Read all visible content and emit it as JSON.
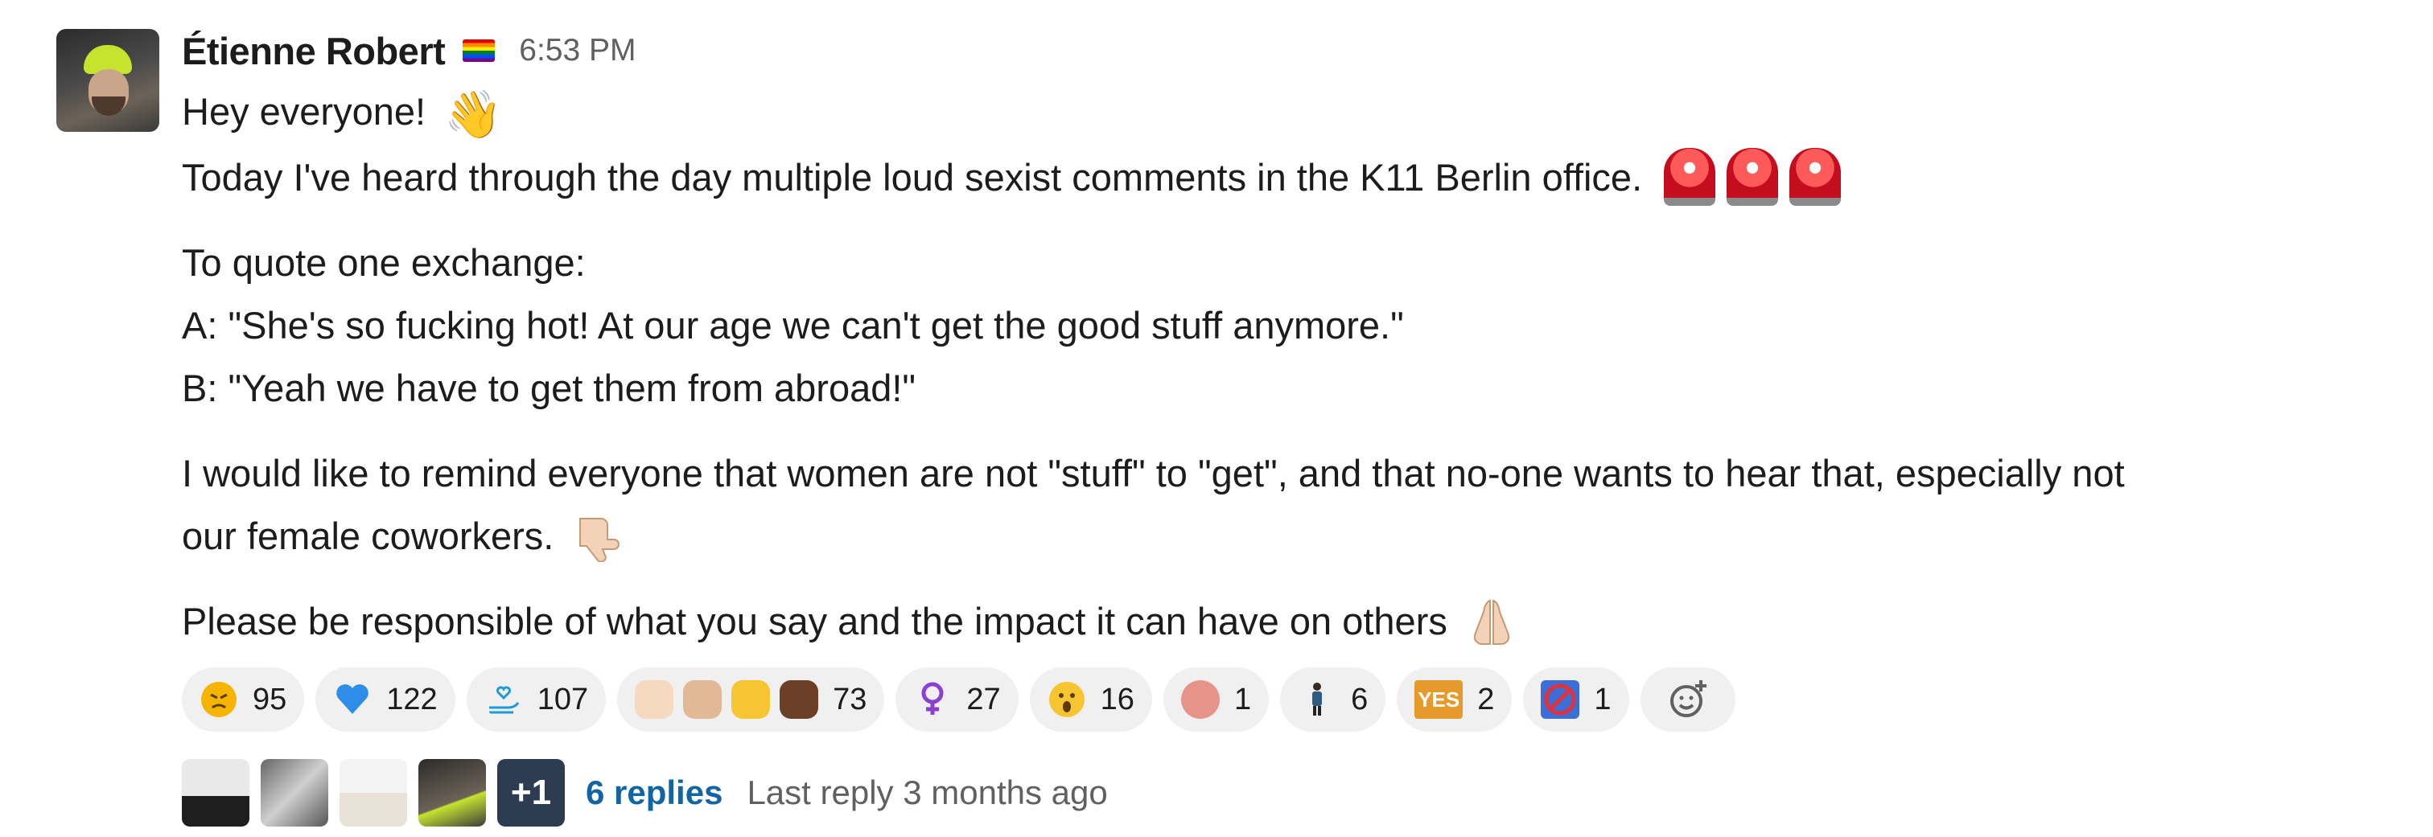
{
  "message": {
    "author": "Étienne Robert",
    "timestamp": "6:53 PM",
    "lines": {
      "greeting": "Hey everyone!",
      "l1": "Today I've heard through the day multiple loud sexist comments in the K11 Berlin office.",
      "q0": "To quote one exchange:",
      "q1": "A: \"She's so fucking hot! At our age we can't get the good stuff anymore.\"",
      "q2": "B: \"Yeah we have to get them from abroad!\"",
      "r1": "I would like to remind everyone that women are not \"stuff\" to \"get\", and that no-one wants to hear that, especially not",
      "r2": "our female coworkers.",
      "p1": "Please be responsible of what you say and the impact it can have on others"
    }
  },
  "reactions": [
    {
      "icon": "angry-face-icon",
      "count": "95"
    },
    {
      "icon": "blue-heart-icon",
      "count": "122"
    },
    {
      "icon": "helping-hand-heart-icon",
      "count": "107"
    },
    {
      "icon": "raised-fist-skin-tones-icon",
      "count": "73"
    },
    {
      "icon": "female-sign-icon",
      "count": "27"
    },
    {
      "icon": "astonished-face-icon",
      "count": "16"
    },
    {
      "icon": "custom-badge-icon",
      "count": "1"
    },
    {
      "icon": "person-standing-icon",
      "count": "6"
    },
    {
      "icon": "yes-icon",
      "label": "YES",
      "count": "2"
    },
    {
      "icon": "no-sign-icon",
      "count": "1"
    }
  ],
  "thread": {
    "overflow": "+1",
    "replies": "6 replies",
    "last_reply": "Last reply 3 months ago"
  },
  "colors": {
    "link": "#1264a3",
    "muted": "#616061",
    "pill_bg": "#f0f0f1"
  }
}
